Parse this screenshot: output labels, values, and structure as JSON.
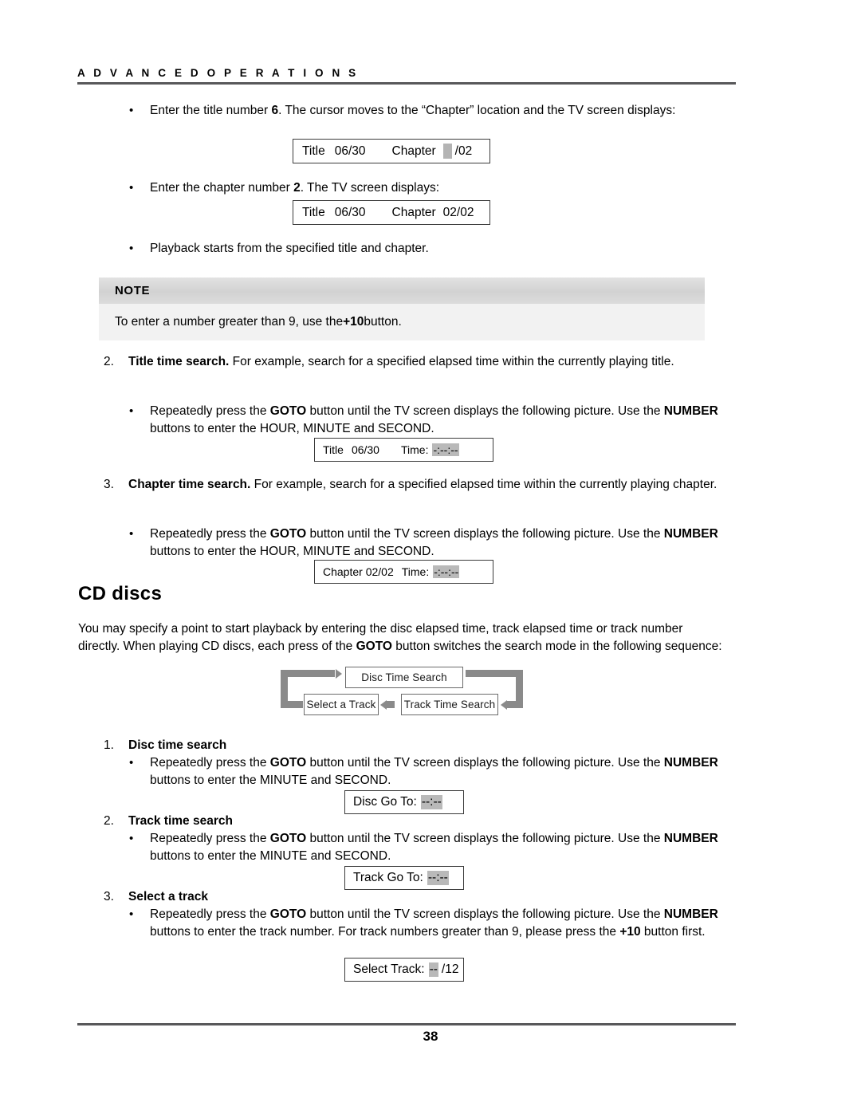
{
  "header": {
    "title": "A D V A N C E D    O P E R A T I O N S"
  },
  "section1": {
    "bullet1": {
      "bullet": "•",
      "text_pre": "Enter the title number ",
      "bold1": "6",
      "text_mid": ". The cursor moves to the “Chapter” location and the TV screen displays:"
    },
    "display1": {
      "label_title": "Title",
      "value_title": "06/30",
      "label_chapter": "Chapter",
      "value_chapter": "/02"
    },
    "bullet2": {
      "bullet": "•",
      "text_pre": "Enter the chapter number ",
      "bold1": "2",
      "text_mid": ".  The TV screen displays:"
    },
    "display2": {
      "label_title": "Title",
      "value_title": "06/30",
      "label_chapter": "Chapter",
      "value_chapter": "02/02"
    },
    "bullet3": {
      "bullet": "•",
      "text": "Playback starts from the specified title and chapter."
    }
  },
  "note": {
    "heading": "NOTE",
    "text_pre": "To enter a number greater than 9, use the ",
    "bold": "+10",
    "text_post": " button."
  },
  "item2": {
    "number": "2.",
    "bold_lead": "Title time search.",
    "text": "  For example, search for a specified elapsed time within the currently playing title.",
    "bullet": {
      "bullet": "•",
      "text_pre": "Repeatedly press the ",
      "bold1": "GOTO",
      "text_mid": " button until the TV screen displays the following picture.  Use the ",
      "bold2": "NUMBER",
      "text_post": " buttons to enter the HOUR, MINUTE and SECOND."
    },
    "display": {
      "label_title": "Title",
      "value_title": "06/30",
      "label_time": "Time:",
      "value_time": "-:--:--"
    }
  },
  "item3": {
    "number": "3.",
    "bold_lead": "Chapter time search.",
    "text": "  For example, search for a specified elapsed time within the currently playing chapter.",
    "bullet": {
      "bullet": "•",
      "text_pre": "Repeatedly press the ",
      "bold1": "GOTO",
      "text_mid": " button until the TV screen displays the following picture.  Use the ",
      "bold2": "NUMBER",
      "text_post": " buttons to enter the HOUR, MINUTE and SECOND."
    },
    "display": {
      "label_chapter": "Chapter 02/02",
      "label_time": "Time:",
      "value_time": "-:--:--"
    }
  },
  "cd": {
    "heading": "CD discs",
    "paragraph_pre": "You may specify a point to start playback by entering the disc elapsed time, track elapsed time or track number directly.  When playing CD discs, each press of the ",
    "paragraph_bold": "GOTO",
    "paragraph_post": " button switches the search mode in the following sequence:"
  },
  "diagram": {
    "box_disc": "Disc Time Search",
    "box_track_time": "Track Time Search",
    "box_select": "Select a Track"
  },
  "step1": {
    "number": "1.",
    "heading": "Disc time search",
    "bullet": {
      "bullet": "•",
      "text_pre": "Repeatedly press the ",
      "bold1": "GOTO",
      "text_mid": " button until the TV screen displays the following picture.  Use the ",
      "bold2": "NUMBER",
      "text_post": " buttons to enter the MINUTE and SECOND."
    },
    "display": {
      "label": "Disc Go To:",
      "value": "--:--"
    }
  },
  "step2": {
    "number": "2.",
    "heading": "Track time search",
    "bullet": {
      "bullet": "•",
      "text_pre": "Repeatedly press the ",
      "bold1": "GOTO",
      "text_mid": " button until the TV screen displays the following picture.  Use the ",
      "bold2": "NUMBER",
      "text_post": " buttons to enter the MINUTE and SECOND."
    },
    "display": {
      "label": "Track Go To:",
      "value": "--:--"
    }
  },
  "step3": {
    "number": "3.",
    "heading": "Select a track",
    "bullet": {
      "bullet": "•",
      "text_pre": "Repeatedly press the ",
      "bold1": "GOTO",
      "text_mid": " button until the TV screen displays the following picture.  Use the ",
      "bold2": "NUMBER",
      "text_post": " buttons to enter the track number.  For track numbers greater than 9, please press the ",
      "bold3": "+10",
      "text_end": " button first."
    },
    "display": {
      "label": "Select Track:",
      "value": "--",
      "total": "/12"
    }
  },
  "footer": {
    "page_number": "38"
  }
}
